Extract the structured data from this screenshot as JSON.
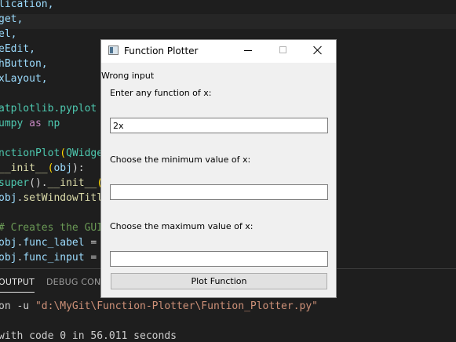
{
  "editor": {
    "lines": [
      {
        "segments": [
          {
            "t": "lication,",
            "c": "v"
          }
        ]
      },
      {
        "segments": [
          {
            "t": "get,",
            "c": "v"
          }
        ]
      },
      {
        "segments": [
          {
            "t": "el,",
            "c": "v"
          }
        ]
      },
      {
        "segments": [
          {
            "t": "eEdit,",
            "c": "v"
          }
        ]
      },
      {
        "segments": [
          {
            "t": "hButton,",
            "c": "v"
          }
        ]
      },
      {
        "segments": [
          {
            "t": "xLayout,",
            "c": "v"
          }
        ]
      },
      {
        "segments": [
          {
            "t": "",
            "c": "d"
          }
        ]
      },
      {
        "segments": [
          {
            "t": "atplotlib.pyplot",
            "c": "c"
          }
        ]
      },
      {
        "segments": [
          {
            "t": "umpy ",
            "c": "c"
          },
          {
            "t": "as",
            "c": "k"
          },
          {
            "t": " np",
            "c": "c"
          }
        ]
      },
      {
        "segments": [
          {
            "t": "",
            "c": "d"
          }
        ]
      },
      {
        "segments": [
          {
            "t": "nctionPlot",
            "c": "c"
          },
          {
            "t": "(",
            "c": "p"
          },
          {
            "t": "QWidge",
            "c": "c"
          }
        ]
      },
      {
        "segments": [
          {
            "t": "__init__",
            "c": "f"
          },
          {
            "t": "(",
            "c": "p"
          },
          {
            "t": "obj",
            "c": "v"
          },
          {
            "t": "):",
            "c": "d"
          }
        ]
      },
      {
        "segments": [
          {
            "t": "super",
            "c": "c"
          },
          {
            "t": "().",
            "c": "d"
          },
          {
            "t": "__init__",
            "c": "f"
          },
          {
            "t": "(",
            "c": "p"
          }
        ]
      },
      {
        "segments": [
          {
            "t": "obj",
            "c": "v"
          },
          {
            "t": ".",
            "c": "d"
          },
          {
            "t": "setWindowTitl",
            "c": "f"
          }
        ]
      },
      {
        "segments": [
          {
            "t": "",
            "c": "d"
          }
        ]
      },
      {
        "segments": [
          {
            "t": "# Creates the GUI",
            "c": "cm"
          }
        ]
      },
      {
        "segments": [
          {
            "t": "obj",
            "c": "v"
          },
          {
            "t": ".",
            "c": "d"
          },
          {
            "t": "func_label",
            "c": "v"
          },
          {
            "t": " =",
            "c": "d"
          }
        ]
      },
      {
        "segments": [
          {
            "t": "obj",
            "c": "v"
          },
          {
            "t": ".",
            "c": "d"
          },
          {
            "t": "func_input",
            "c": "v"
          },
          {
            "t": " =",
            "c": "d"
          }
        ]
      }
    ]
  },
  "panel": {
    "tabs": [
      {
        "label": "OUTPUT"
      },
      {
        "label": "DEBUG CONSOLE"
      }
    ],
    "terminal": {
      "line1_prefix": "on -u ",
      "line1_path": "\"d:\\MyGit\\Function-Plotter\\Funtion_Plotter.py\"",
      "line2": "with code 0 in 56.011 seconds"
    }
  },
  "window": {
    "title": "Function Plotter",
    "error_label": "Wrong input",
    "func_label": "Enter any function of x:",
    "func_value": "2x",
    "min_label": "Choose the minimum value of x:",
    "min_value": "",
    "max_label": "Choose the maximum value of x:",
    "max_value": "",
    "plot_button": "Plot Function"
  },
  "icons": {
    "app": "app-window-icon",
    "minimize": "minimize-icon",
    "maximize": "maximize-icon",
    "close": "close-icon"
  }
}
